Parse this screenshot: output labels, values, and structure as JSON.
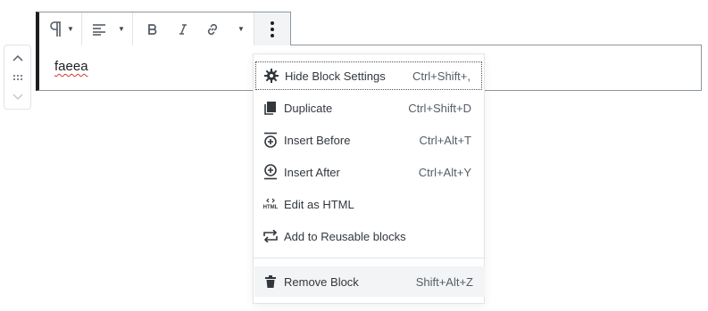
{
  "block": {
    "text": "faeea"
  },
  "mover": {
    "icons": [
      "chevron-up-icon",
      "drag-handle-icon",
      "chevron-down-icon"
    ]
  },
  "toolbar": {
    "buttons": [
      "paragraph-icon",
      "align-left-icon",
      "bold-icon",
      "italic-icon",
      "link-icon",
      "more-options-icon"
    ]
  },
  "menu": {
    "items": [
      {
        "label": "Hide Block Settings",
        "shortcut": "Ctrl+Shift+,",
        "icon": "gear-icon"
      },
      {
        "label": "Duplicate",
        "shortcut": "Ctrl+Shift+D",
        "icon": "duplicate-icon"
      },
      {
        "label": "Insert Before",
        "shortcut": "Ctrl+Alt+T",
        "icon": "insert-before-icon"
      },
      {
        "label": "Insert After",
        "shortcut": "Ctrl+Alt+Y",
        "icon": "insert-after-icon"
      },
      {
        "label": "Edit as HTML",
        "shortcut": "",
        "icon": "html-icon"
      },
      {
        "label": "Add to Reusable blocks",
        "shortcut": "",
        "icon": "reusable-icon"
      },
      {
        "label": "Remove Block",
        "shortcut": "Shift+Alt+Z",
        "icon": "trash-icon"
      }
    ],
    "html_icon_text": "HTML"
  }
}
